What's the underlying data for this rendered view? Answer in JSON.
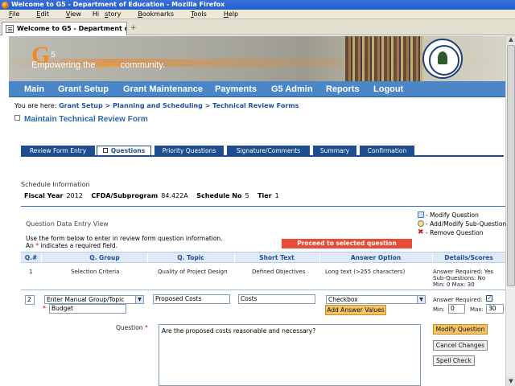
{
  "window": {
    "title": "Welcome to G5 - Department of Education - Mozilla Firefox"
  },
  "menu": [
    {
      "label": "File",
      "u": "F"
    },
    {
      "label": "Edit",
      "u": "E"
    },
    {
      "label": "View",
      "u": "V"
    },
    {
      "label": "History",
      "u": "s"
    },
    {
      "label": "Bookmarks",
      "u": "B"
    },
    {
      "label": "Tools",
      "u": "T"
    },
    {
      "label": "Help",
      "u": "H"
    }
  ],
  "browser_tab": {
    "label": "Welcome to G5 - Department of Edu...",
    "new_tab": "+"
  },
  "banner": {
    "logo": "G5",
    "logo_sup": "5",
    "tagline_pre": "Empowering the ",
    "tagline_hl": "grant",
    "tagline_post": " community."
  },
  "nav": [
    "Main",
    "Grant Setup",
    "Grant Maintenance",
    "Payments",
    "G5 Admin",
    "Reports",
    "Logout"
  ],
  "breadcrumb": {
    "prefix": "You are here: ",
    "path": "Grant Setup > Planning and Scheduling > Technical Review Forms"
  },
  "page_title": "Maintain Technical Review Form",
  "form_tabs": [
    "Review Form Entry",
    "Questions",
    "Priority Questions",
    "Signature/Comments",
    "Summary",
    "Confirmation"
  ],
  "schedule": {
    "label": "Schedule Information",
    "fiscal_year_label": "Fiscal Year",
    "fiscal_year": "2012",
    "cfda_label": "CFDA/Subprogram",
    "cfda": "84.422A",
    "schedule_no_label": "Schedule No",
    "schedule_no": "5",
    "tier_label": "Tier",
    "tier": "1"
  },
  "qde": {
    "title": "Question Data Entry View",
    "instr1": "Use the form below to enter in review form question information.",
    "instr2_pre": "An ",
    "instr2_star": "*",
    "instr2_post": " indicates a required field."
  },
  "legend": [
    "- Modify Question",
    "- Add/Modify Sub-Question",
    "- Remove Question"
  ],
  "proceed_label": "Proceed to selected question",
  "table": {
    "headers": [
      "Q.#",
      "Q. Group",
      "Q. Topic",
      "Short Text",
      "Answer Option",
      "Details/Scores"
    ],
    "row": {
      "num": "1",
      "group": "Selection Criteria",
      "topic": "Quality of Project Design",
      "short": "Defined Objectives",
      "answer": "Long text (>255 characters)",
      "details1": "Answer Required: Yes",
      "details2": "Sub-Questions: No",
      "details3": "Min: 0  Max: 30"
    }
  },
  "edit": {
    "num": "2",
    "group_select": "Enter Manual Group/Topic",
    "group_star": "*",
    "group_input": "Budget",
    "topic": "Proposed Costs",
    "short": "Costs",
    "answer_select": "Checkbox",
    "add_answer_label": "Add Answer Values",
    "answer_required_label": "Answer Required:",
    "min_label": "Min:",
    "min": "0",
    "max_label": "Max:",
    "max": "30",
    "question_label": "Question",
    "question_star": "*",
    "question_text": "Are the proposed costs reasonable and necessary?",
    "modify_label": "Modify Question",
    "cancel_label": "Cancel Changes",
    "spell_label": "Spell Check"
  }
}
